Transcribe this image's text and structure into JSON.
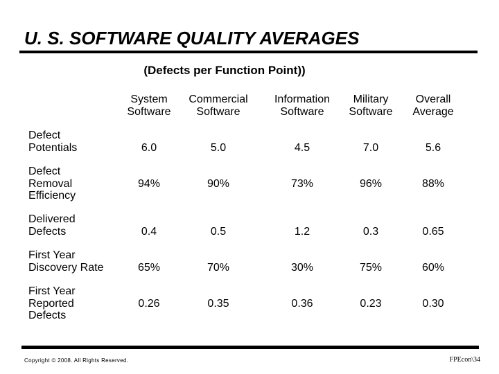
{
  "title": "U. S. SOFTWARE QUALITY AVERAGES",
  "subtitle": "(Defects per Function Point))",
  "columns": [
    {
      "line1": "System",
      "line2": "Software"
    },
    {
      "line1": "Commercial",
      "line2": "Software"
    },
    {
      "line1": "Information",
      "line2": "Software"
    },
    {
      "line1": "Military",
      "line2": "Software"
    },
    {
      "line1": "Overall",
      "line2": "Average"
    }
  ],
  "rows": [
    {
      "label": [
        "Defect",
        "Potentials"
      ],
      "values": [
        "6.0",
        "5.0",
        "4.5",
        "7.0",
        "5.6"
      ]
    },
    {
      "label": [
        "Defect",
        "Removal",
        "Efficiency"
      ],
      "values": [
        "94%",
        "90%",
        "73%",
        "96%",
        "88%"
      ]
    },
    {
      "label": [
        "Delivered",
        "Defects"
      ],
      "values": [
        "0.4",
        "0.5",
        "1.2",
        "0.3",
        "0.65"
      ]
    },
    {
      "label": [
        "First Year",
        "Discovery Rate"
      ],
      "values": [
        "65%",
        "70%",
        "30%",
        "75%",
        "60%"
      ]
    },
    {
      "label": [
        "First Year",
        "Reported",
        "Defects"
      ],
      "values": [
        "0.26",
        "0.35",
        "0.36",
        "0.23",
        "0.30"
      ]
    }
  ],
  "footer": {
    "copyright": "Copyright © 2008.  All Rights Reserved.",
    "page_ref": "FPEcon\\34"
  }
}
